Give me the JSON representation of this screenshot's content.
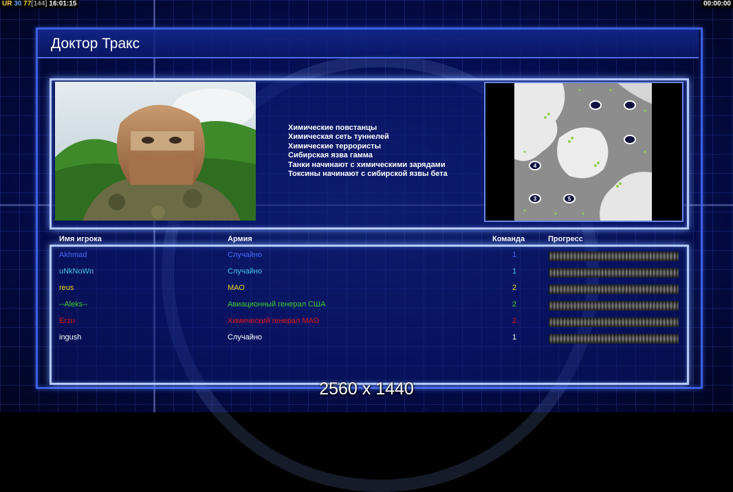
{
  "overlay": {
    "ur": "UR",
    "n1": "30",
    "n2": "77",
    "n3": "[144]",
    "clock": "16:01:15",
    "timer": "00:00:00"
  },
  "title": "Доктор Тракс",
  "rules": [
    "Химические повстанцы",
    "Химическая сеть туннелей",
    "Химические террористы",
    "Сибирская язва гамма",
    "Танки начинают с химическими зарядами",
    "Токсины начинают с сибирской язвы бета"
  ],
  "minimap": {
    "slots": [
      "3",
      "4",
      "5"
    ]
  },
  "table": {
    "headers": {
      "name": "Имя игрока",
      "army": "Армия",
      "team": "Команда",
      "progress": "Прогресс"
    },
    "rows": [
      {
        "name": "Akhmad",
        "army": "Случайно",
        "team": "1",
        "color": "#4a6cff",
        "progress": 1.0
      },
      {
        "name": "uNkNoWn",
        "army": "Случайно",
        "team": "1",
        "color": "#3fc8e6",
        "progress": 1.0
      },
      {
        "name": "reus",
        "army": "МАО",
        "team": "2",
        "color": "#f2d21c",
        "progress": 1.0
      },
      {
        "name": "--Aleks--",
        "army": "Авиационный генерал США",
        "team": "2",
        "color": "#3ccf2e",
        "progress": 1.0
      },
      {
        "name": "Erzu",
        "army": "Химический генерал МАО",
        "team": "2",
        "color": "#e81818",
        "progress": 1.0
      },
      {
        "name": "ingush",
        "army": "Случайно",
        "team": "1",
        "color": "#ffffff",
        "progress": 1.0
      }
    ]
  },
  "resolution": "2560 x 1440"
}
